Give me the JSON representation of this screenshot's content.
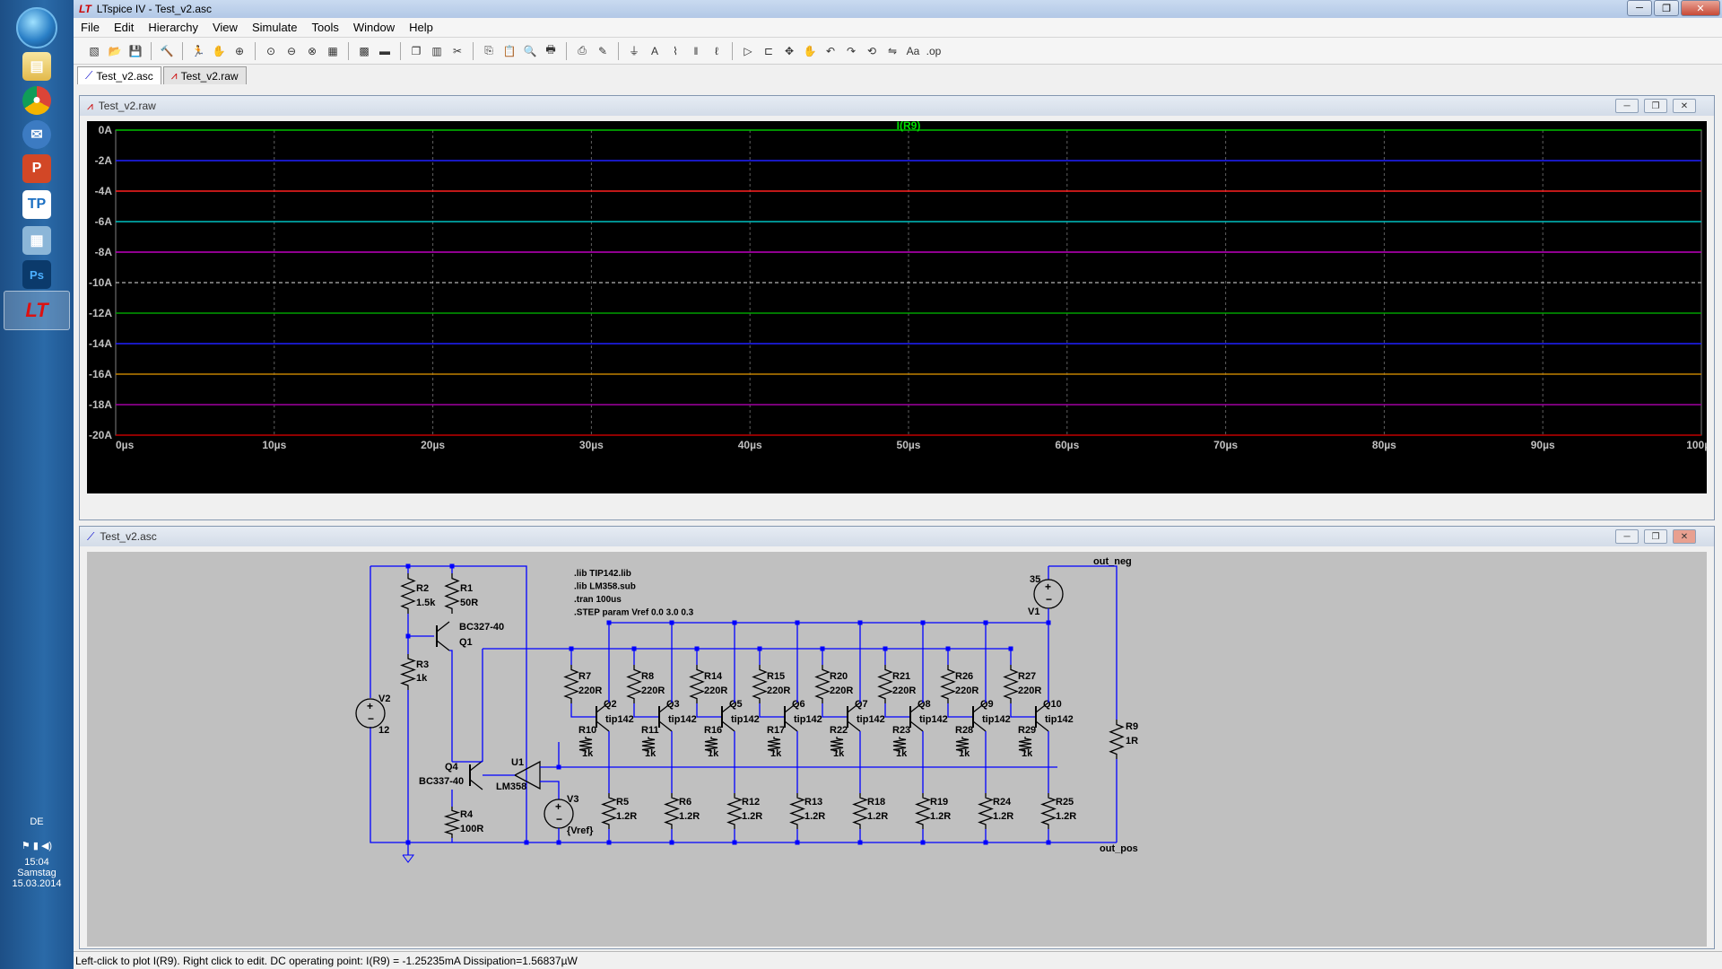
{
  "window": {
    "title": "LTspice IV - Test_v2.asc"
  },
  "menu": [
    "File",
    "Edit",
    "Hierarchy",
    "View",
    "Simulate",
    "Tools",
    "Window",
    "Help"
  ],
  "toolbar_icons": [
    "new-schematic-icon",
    "open-icon",
    "save-icon",
    "control-panel-icon",
    "run-icon",
    "halt-icon",
    "zoom-in-icon",
    "zoom-pan-icon",
    "zoom-out-icon",
    "zoom-fit-icon",
    "autorange-icon",
    "grid-icon",
    "tile-horizontal-icon",
    "cascade-icon",
    "tile-vertical-icon",
    "cut-icon",
    "copy-icon",
    "paste-icon",
    "find-icon",
    "print-icon",
    "print-preview-icon",
    "wire-icon",
    "ground-icon",
    "label-icon",
    "resistor-icon",
    "capacitor-icon",
    "inductor-icon",
    "diode-icon",
    "component-icon",
    "move-icon",
    "drag-icon",
    "undo-icon",
    "redo-icon",
    "rotate-icon",
    "mirror-icon",
    "text-icon",
    "spice-directive-icon"
  ],
  "tabs": [
    {
      "label": "Test_v2.asc",
      "active": true
    },
    {
      "label": "Test_v2.raw",
      "active": false
    }
  ],
  "plot_window": {
    "title": "Test_v2.raw"
  },
  "schematic_window": {
    "title": "Test_v2.asc"
  },
  "chart_data": {
    "type": "line",
    "title": "I(R9)",
    "xlabel": "",
    "ylabel": "",
    "x_ticks": [
      "0µs",
      "10µs",
      "20µs",
      "30µs",
      "40µs",
      "50µs",
      "60µs",
      "70µs",
      "80µs",
      "90µs",
      "100µs"
    ],
    "y_ticks": [
      "0A",
      "-2A",
      "-4A",
      "-6A",
      "-8A",
      "-10A",
      "-12A",
      "-14A",
      "-16A",
      "-18A",
      "-20A"
    ],
    "xlim": [
      0,
      100
    ],
    "ylim": [
      -20,
      0
    ],
    "grid": true,
    "series": [
      {
        "y": 0,
        "color": "#00c000"
      },
      {
        "y": -2,
        "color": "#2020ff"
      },
      {
        "y": -4,
        "color": "#ff2020"
      },
      {
        "y": -6,
        "color": "#00c0c0"
      },
      {
        "y": -8,
        "color": "#c000c0"
      },
      {
        "y": -12,
        "color": "#00a000"
      },
      {
        "y": -14,
        "color": "#2020ff"
      },
      {
        "y": -16,
        "color": "#c08000"
      },
      {
        "y": -18,
        "color": "#a000a0"
      },
      {
        "y": -20,
        "color": "#c00000"
      }
    ],
    "dashed_line_y": -10
  },
  "schematic": {
    "directives": [
      ".lib TIP142.lib",
      ".lib LM358.sub",
      ".tran 100us",
      ".STEP param Vref 0.0 3.0 0.3"
    ],
    "labels": {
      "R2": "R2",
      "R2v": "1.5k",
      "R1": "R1",
      "R1v": "50R",
      "Q1t": "BC327-40",
      "Q1": "Q1",
      "R3": "R3",
      "R3v": "1k",
      "V2": "V2",
      "V2v": "12",
      "Q4": "Q4",
      "Q4t": "BC337-40",
      "R4": "R4",
      "R4v": "100R",
      "U1": "U1",
      "U1t": "LM358",
      "V3": "V3",
      "V3v": "{Vref}",
      "V1v": "35",
      "V1": "V1",
      "out_neg": "out_neg",
      "out_pos": "out_pos",
      "R9": "R9",
      "R9v": "1R"
    },
    "stages": [
      {
        "rb": "R7",
        "rbv": "220R",
        "q": "Q2",
        "qt": "tip142",
        "rl": "R10",
        "rlv": "1k",
        "re": "R5",
        "rev": "1.2R"
      },
      {
        "rb": "R8",
        "rbv": "220R",
        "q": "Q3",
        "qt": "tip142",
        "rl": "R11",
        "rlv": "1k",
        "re": "R6",
        "rev": "1.2R"
      },
      {
        "rb": "R14",
        "rbv": "220R",
        "q": "Q5",
        "qt": "tip142",
        "rl": "R16",
        "rlv": "1k",
        "re": "R12",
        "rev": "1.2R"
      },
      {
        "rb": "R15",
        "rbv": "220R",
        "q": "Q6",
        "qt": "tip142",
        "rl": "R17",
        "rlv": "1k",
        "re": "R13",
        "rev": "1.2R"
      },
      {
        "rb": "R20",
        "rbv": "220R",
        "q": "Q7",
        "qt": "tip142",
        "rl": "R22",
        "rlv": "1k",
        "re": "R18",
        "rev": "1.2R"
      },
      {
        "rb": "R21",
        "rbv": "220R",
        "q": "Q8",
        "qt": "tip142",
        "rl": "R23",
        "rlv": "1k",
        "re": "R19",
        "rev": "1.2R"
      },
      {
        "rb": "R26",
        "rbv": "220R",
        "q": "Q9",
        "qt": "tip142",
        "rl": "R28",
        "rlv": "1k",
        "re": "R24",
        "rev": "1.2R"
      },
      {
        "rb": "R27",
        "rbv": "220R",
        "q": "Q10",
        "qt": "tip142",
        "rl": "R29",
        "rlv": "1k",
        "re": "R25",
        "rev": "1.2R"
      }
    ]
  },
  "status": "Left-click to plot I(R9).  Right click to edit.  DC operating point: I(R9) = -1.25235mA   Dissipation=1.56837µW",
  "tray": {
    "lang": "DE",
    "time": "15:04",
    "day": "Samstag",
    "date": "15.03.2014"
  },
  "taskbar_icons": [
    "windows-start-icon",
    "file-explorer-icon",
    "chrome-icon",
    "thunderbird-icon",
    "powerpoint-icon",
    "textpad-icon",
    "network-icon",
    "photoshop-icon",
    "ltspice-icon"
  ],
  "colors": {
    "schematic_bg": "#c0c0c0",
    "wire": "#0000ff",
    "plot_bg": "#000000",
    "grid": "#808080"
  }
}
